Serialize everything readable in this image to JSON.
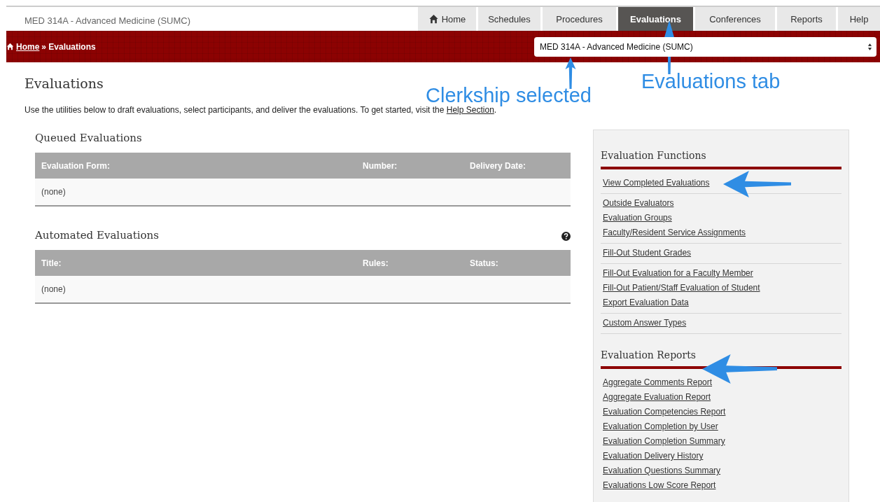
{
  "header": {
    "course": "MED 314A - Advanced Medicine (SUMC)",
    "tabs": [
      {
        "label": "Home",
        "selected": false
      },
      {
        "label": "Schedules",
        "selected": false
      },
      {
        "label": "Procedures",
        "selected": false
      },
      {
        "label": "Evaluations",
        "selected": true
      },
      {
        "label": "Conferences",
        "selected": false
      },
      {
        "label": "Reports",
        "selected": false
      },
      {
        "label": "Help",
        "selected": false
      }
    ]
  },
  "breadcrumb": {
    "home": "Home",
    "separator": "»",
    "current": "Evaluations"
  },
  "course_select": {
    "value": "MED 314A - Advanced Medicine (SUMC)"
  },
  "page": {
    "title": "Evaluations",
    "intro": "Use the utilities below to draft evaluations, select participants, and deliver the evaluations. To get started, visit the ",
    "intro_link": "Help Section",
    "intro_end": "."
  },
  "sections": [
    {
      "title": "Queued Evaluations",
      "help": false,
      "columns": [
        "Evaluation Form:",
        "Number:",
        "Delivery Date:"
      ],
      "empty": "(none)"
    },
    {
      "title": "Automated Evaluations",
      "help": true,
      "columns": [
        "Title:",
        "Rules:",
        "Status:"
      ],
      "empty": "(none)"
    }
  ],
  "sidebar": [
    {
      "title": "Evaluation Functions",
      "groups": [
        [
          "View Completed Evaluations"
        ],
        [
          "Outside Evaluators",
          "Evaluation Groups",
          "Faculty/Resident Service Assignments"
        ],
        [
          "Fill-Out Student Grades"
        ],
        [
          "Fill-Out Evaluation for a Faculty Member",
          "Fill-Out Patient/Staff Evaluation of Student",
          "Export Evaluation Data"
        ],
        [
          "Custom Answer Types"
        ]
      ]
    },
    {
      "title": "Evaluation Reports",
      "groups": [
        [
          "Aggregate Comments Report",
          "Aggregate Evaluation Report",
          "Evaluation Competencies Report",
          "Evaluation Completion by User",
          "Evaluation Completion Summary",
          "Evaluation Delivery History",
          "Evaluation Questions Summary",
          "Evaluations Low Score Report"
        ]
      ]
    }
  ],
  "callouts": [
    {
      "text": "Clerkship selected"
    },
    {
      "text": "Evaluations tab"
    }
  ],
  "pointer_arrows": [
    {
      "kind": "up"
    },
    {
      "kind": "up"
    },
    {
      "kind": "left"
    },
    {
      "kind": "left"
    }
  ]
}
